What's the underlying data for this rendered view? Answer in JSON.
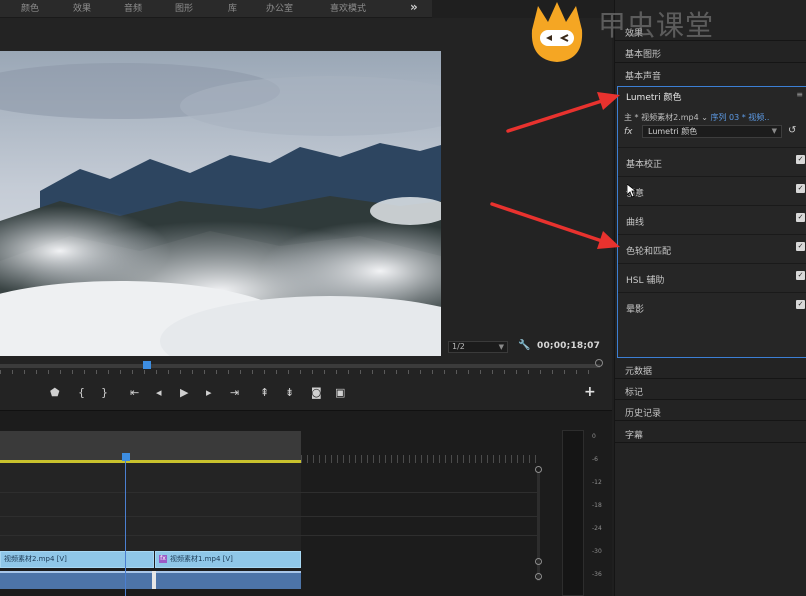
{
  "topbar": {
    "workspaces": [
      "颜色",
      "效果",
      "音频",
      "图形",
      "库",
      "办公室",
      "喜欢模式"
    ],
    "overflow": "»"
  },
  "monitor": {
    "zoom_value": "1/2",
    "timecode": "00;00;18;07"
  },
  "timeline": {
    "clip1_label": "视频素材2.mp4 [V]",
    "clip2_label": "视频素材1.mp4 [V]",
    "clip2_fx": "fx"
  },
  "meter": {
    "labels": [
      "0",
      "-6",
      "-12",
      "-18",
      "-24",
      "-30",
      "-36"
    ]
  },
  "panel": {
    "headers_top": [
      "效果",
      "基本图形",
      "基本声音"
    ],
    "lumetri_title": "Lumetri 颜色",
    "source_prefix": "主 * 视频素材2.mp4 ⌄",
    "sequence_text": "序列 03 * 视频..",
    "fx_label": "fx",
    "effect_select": "Lumetri 颜色",
    "sections": [
      "基本校正",
      "创意",
      "曲线",
      "色轮和匹配",
      "HSL 辅助",
      "晕影"
    ],
    "headers_bottom": [
      "元数据",
      "标记",
      "历史记录",
      "字幕"
    ]
  },
  "brand": {
    "watermark": "甲虫课堂",
    "logo_color": "#f5a623"
  },
  "colors": {
    "accent_blue": "#3c7fd4",
    "arrow_red": "#e8322e",
    "work_area_yellow": "#c9c22d",
    "clip_video": "#8fc7e8",
    "clip_audio": "#4d74a8"
  }
}
